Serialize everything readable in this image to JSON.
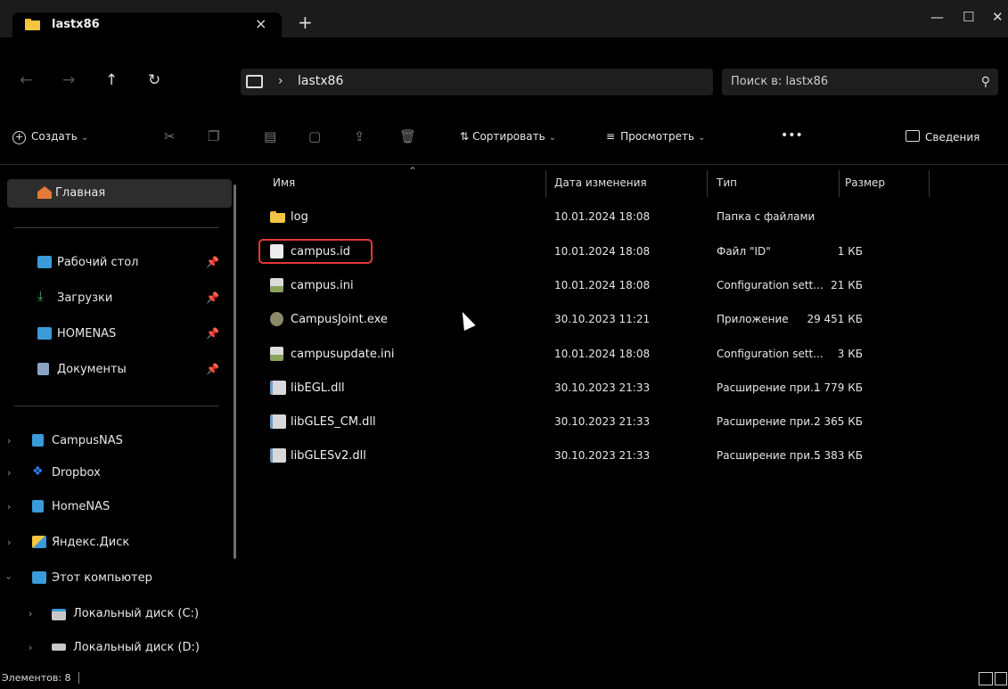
{
  "window": {
    "tab_title": "lastx86",
    "tab_close": "×",
    "tab_add": "+",
    "minimize": "—",
    "maximize": "☐",
    "close": "✕"
  },
  "address": {
    "back": "←",
    "forward": "→",
    "up": "↑",
    "refresh": "↻",
    "separator": "›",
    "breadcrumb": "lastx86",
    "search_placeholder": "Поиск в: lastx86",
    "search_icon": "⚲"
  },
  "commands": {
    "new_label": "Создать",
    "sort_label": "Сортировать",
    "view_label": "Просмотреть",
    "more_label": "•••",
    "details_label": "Сведения"
  },
  "sidebar": {
    "home": "Главная",
    "pinned": [
      {
        "label": "Рабочий стол",
        "icon": "desktop-icon"
      },
      {
        "label": "Загрузки",
        "icon": "download-icon"
      },
      {
        "label": "HOMENAS",
        "icon": "drive-icon"
      },
      {
        "label": "Документы",
        "icon": "documents-icon"
      }
    ],
    "locations": [
      {
        "label": "CampusNAS"
      },
      {
        "label": "Dropbox"
      },
      {
        "label": "HomeNAS"
      },
      {
        "label": "Яндекс.Диск"
      },
      {
        "label": "Этот компьютер"
      },
      {
        "label": "Локальный диск (C:)"
      },
      {
        "label": "Локальный диск (D:)"
      }
    ]
  },
  "columns": {
    "name": "Имя",
    "date": "Дата изменения",
    "type": "Тип",
    "size": "Размер"
  },
  "files": [
    {
      "name": "log",
      "date": "10.01.2024 18:08",
      "type": "Папка с файлами",
      "size": ""
    },
    {
      "name": "campus.id",
      "date": "10.01.2024 18:08",
      "type": "Файл \"ID\"",
      "size": "1 КБ"
    },
    {
      "name": "campus.ini",
      "date": "10.01.2024 18:08",
      "type": "Configuration sett...",
      "size": "21 КБ"
    },
    {
      "name": "CampusJoint.exe",
      "date": "30.10.2023 11:21",
      "type": "Приложение",
      "size": "29 451 КБ"
    },
    {
      "name": "campusupdate.ini",
      "date": "10.01.2024 18:08",
      "type": "Configuration sett...",
      "size": "3 КБ"
    },
    {
      "name": "libEGL.dll",
      "date": "30.10.2023 21:33",
      "type": "Расширение при...",
      "size": "1 779 КБ"
    },
    {
      "name": "libGLES_CM.dll",
      "date": "30.10.2023 21:33",
      "type": "Расширение при...",
      "size": "2 365 КБ"
    },
    {
      "name": "libGLESv2.dll",
      "date": "30.10.2023 21:33",
      "type": "Расширение при...",
      "size": "5 383 КБ"
    }
  ],
  "status": {
    "items_text": "Элементов: 8"
  },
  "colors": {
    "background": "#000000",
    "titlebar": "#1b1b1b",
    "highlight": "#e53935",
    "folder": "#f4c542"
  }
}
